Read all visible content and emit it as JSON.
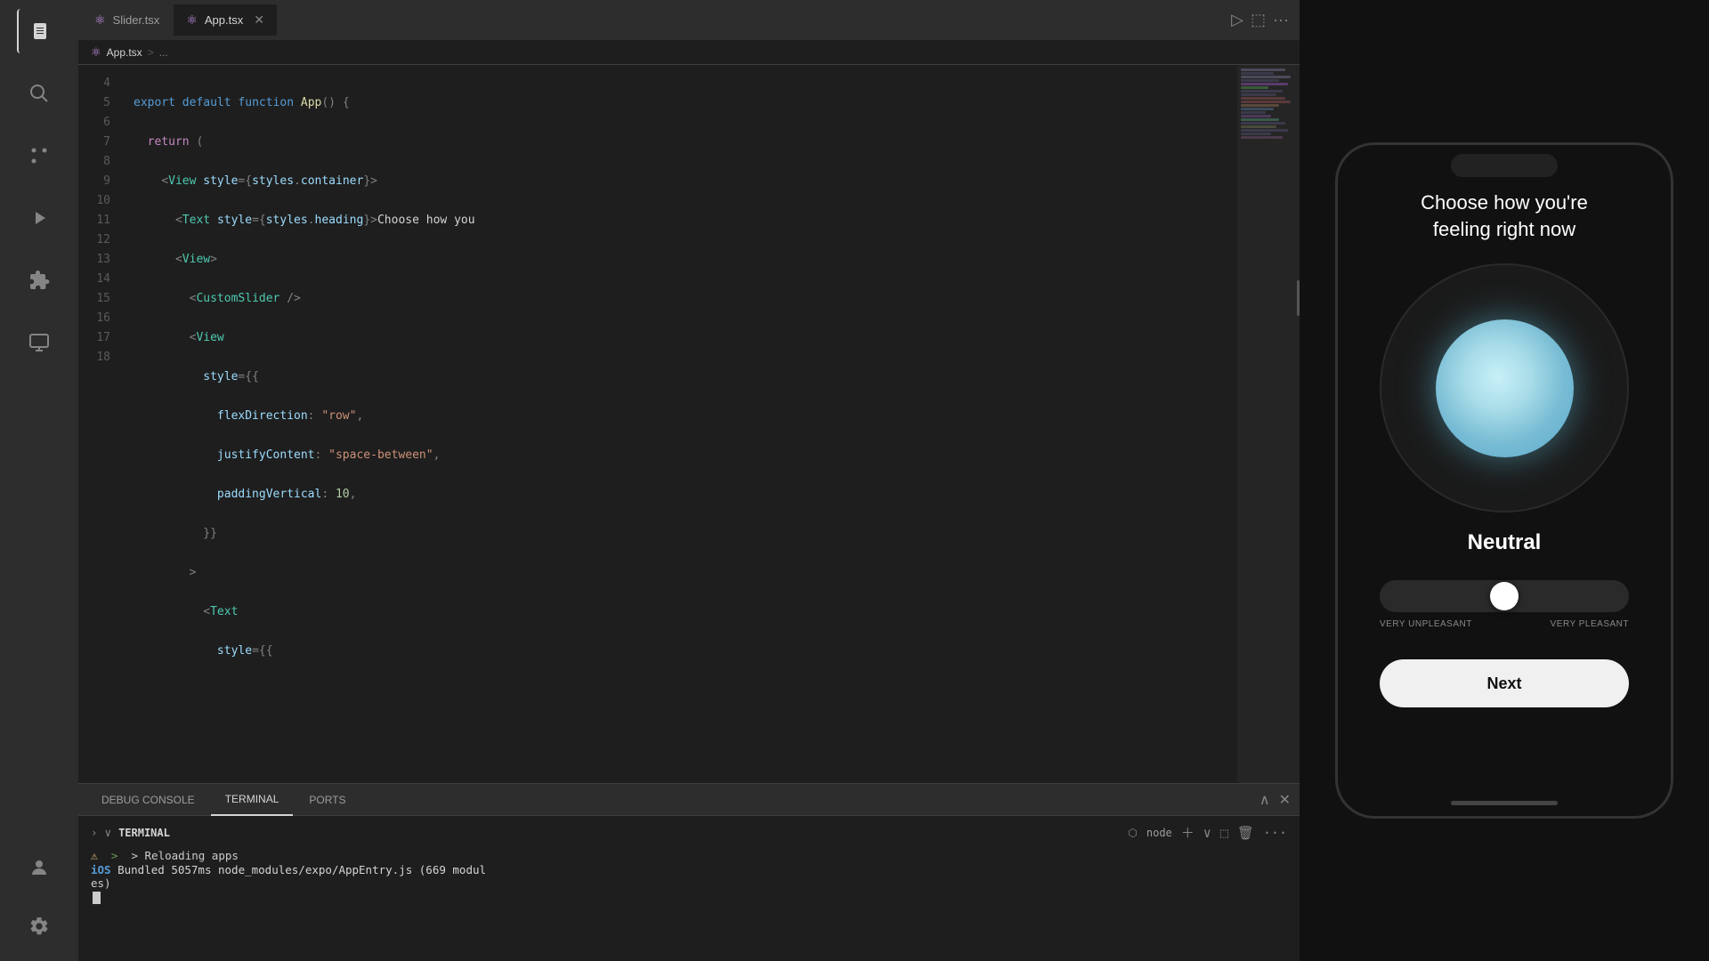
{
  "activityBar": {
    "icons": [
      {
        "name": "files-icon",
        "glyph": "⎘"
      },
      {
        "name": "search-icon",
        "glyph": "🔍"
      },
      {
        "name": "source-control-icon",
        "glyph": "⑂"
      },
      {
        "name": "run-icon",
        "glyph": "▷"
      },
      {
        "name": "extensions-icon",
        "glyph": "⊞"
      },
      {
        "name": "remote-icon",
        "glyph": "⬡"
      }
    ],
    "bottomIcons": [
      {
        "name": "account-icon",
        "glyph": "👤"
      },
      {
        "name": "settings-icon",
        "glyph": "⚙"
      }
    ]
  },
  "tabs": [
    {
      "id": "slider-tab",
      "label": "Slider.tsx",
      "icon": "⚛",
      "active": false,
      "closeable": false
    },
    {
      "id": "app-tab",
      "label": "App.tsx",
      "icon": "⚛",
      "active": true,
      "closeable": true
    }
  ],
  "breadcrumb": {
    "filename": "App.tsx",
    "separator": ">",
    "rest": "..."
  },
  "code": {
    "lines": [
      {
        "num": 4,
        "html": "<span class='kw'>export</span> <span class='kw'>default</span> <span class='kw'>function</span> <span class='fn'>App</span><span class='punc'>() {</span>"
      },
      {
        "num": 5,
        "html": "  <span class='kw2'>return</span> <span class='punc'>(</span>"
      },
      {
        "num": 6,
        "html": "    <span class='punc'>&lt;</span><span class='tag'>View</span> <span class='jsx-attr'>style</span><span class='punc'>={</span><span class='attr'>styles</span><span class='punc'>.</span><span class='attr'>container</span><span class='punc'>}&gt;</span>"
      },
      {
        "num": 7,
        "html": "      <span class='punc'>&lt;</span><span class='tag'>Text</span> <span class='jsx-attr'>style</span><span class='punc'>={</span><span class='attr'>styles</span><span class='punc'>.</span><span class='attr'>heading</span><span class='punc'>}&gt;</span><span class='plain'>Choose how you</span>"
      },
      {
        "num": 8,
        "html": "      <span class='punc'>&lt;</span><span class='tag'>View</span><span class='punc'>&gt;</span>"
      },
      {
        "num": 9,
        "html": "        <span class='punc'>&lt;</span><span class='component'>CustomSlider</span> <span class='punc'>/&gt;</span>"
      },
      {
        "num": 10,
        "html": "        <span class='punc'>&lt;</span><span class='tag'>View</span>"
      },
      {
        "num": 11,
        "html": "          <span class='jsx-attr'>style</span><span class='punc'>=&#123;&#123;</span>"
      },
      {
        "num": 12,
        "html": "            <span class='attr'>flexDirection</span><span class='punc'>:</span> <span class='str'>&quot;row&quot;</span><span class='punc'>,</span>"
      },
      {
        "num": 13,
        "html": "            <span class='attr'>justifyContent</span><span class='punc'>:</span> <span class='str'>&quot;space-between&quot;</span><span class='punc'>,</span>"
      },
      {
        "num": 14,
        "html": "            <span class='attr'>paddingVertical</span><span class='punc'>:</span> <span class='num'>10</span><span class='punc'>,</span>"
      },
      {
        "num": 15,
        "html": "          <span class='punc'>&#125;&#125;</span>"
      },
      {
        "num": 16,
        "html": "        <span class='punc'>&gt;</span>"
      },
      {
        "num": 17,
        "html": "          <span class='punc'>&lt;</span><span class='tag'>Text</span>"
      },
      {
        "num": 18,
        "html": "            <span class='jsx-attr'>style</span><span class='punc'>=&#123;&#123;</span>"
      }
    ]
  },
  "bottomPanel": {
    "tabs": [
      {
        "id": "debug-console",
        "label": "DEBUG CONSOLE",
        "active": false
      },
      {
        "id": "terminal",
        "label": "TERMINAL",
        "active": true
      },
      {
        "id": "ports",
        "label": "PORTS",
        "active": false
      }
    ],
    "terminal": {
      "header": "TERMINAL",
      "shellLabel": "node",
      "line1": "> Reloading apps",
      "line2prefix": "iOS",
      "line2rest": " Bundled 5057ms node_modules/expo/AppEntry.js (669 modul",
      "line3": "es)"
    }
  },
  "phone": {
    "heading": "Choose how you're\nfeeling right now",
    "moodLabel": "Neutral",
    "sliderLabels": {
      "left": "VERY UNPLEASANT",
      "right": "VERY PLEASANT"
    },
    "nextButton": "Next"
  }
}
